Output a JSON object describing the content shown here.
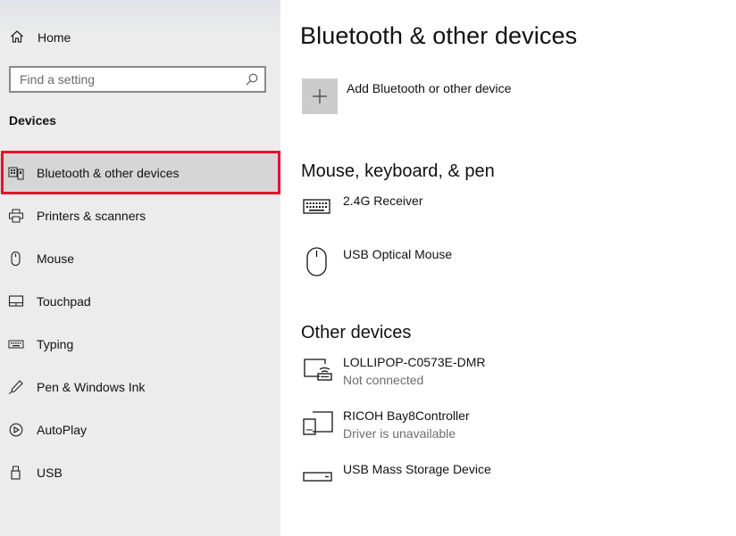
{
  "sidebar": {
    "home_label": "Home",
    "search_placeholder": "Find a setting",
    "section_title": "Devices",
    "items": [
      {
        "label": "Bluetooth & other devices",
        "icon": "bluetooth-devices-icon"
      },
      {
        "label": "Printers & scanners",
        "icon": "printer-icon"
      },
      {
        "label": "Mouse",
        "icon": "mouse-icon"
      },
      {
        "label": "Touchpad",
        "icon": "touchpad-icon"
      },
      {
        "label": "Typing",
        "icon": "keyboard-icon"
      },
      {
        "label": "Pen & Windows Ink",
        "icon": "pen-icon"
      },
      {
        "label": "AutoPlay",
        "icon": "autoplay-icon"
      },
      {
        "label": "USB",
        "icon": "usb-icon"
      }
    ],
    "active_index": 0,
    "highlight_color": "#e8132d"
  },
  "main": {
    "title": "Bluetooth & other devices",
    "add_device_label": "Add Bluetooth or other device",
    "mouse_section": {
      "title": "Mouse, keyboard, & pen",
      "devices": [
        {
          "name": "2.4G Receiver",
          "status": "",
          "icon": "keyboard-icon"
        },
        {
          "name": "USB Optical Mouse",
          "status": "",
          "icon": "mouse-icon"
        }
      ]
    },
    "other_section": {
      "title": "Other devices",
      "devices": [
        {
          "name": "LOLLIPOP-C0573E-DMR",
          "status": "Not connected",
          "icon": "wireless-display-icon"
        },
        {
          "name": "RICOH Bay8Controller",
          "status": "Driver is unavailable",
          "icon": "generic-device-icon"
        },
        {
          "name": "USB Mass Storage Device",
          "status": "",
          "icon": "storage-drive-icon"
        }
      ]
    }
  }
}
